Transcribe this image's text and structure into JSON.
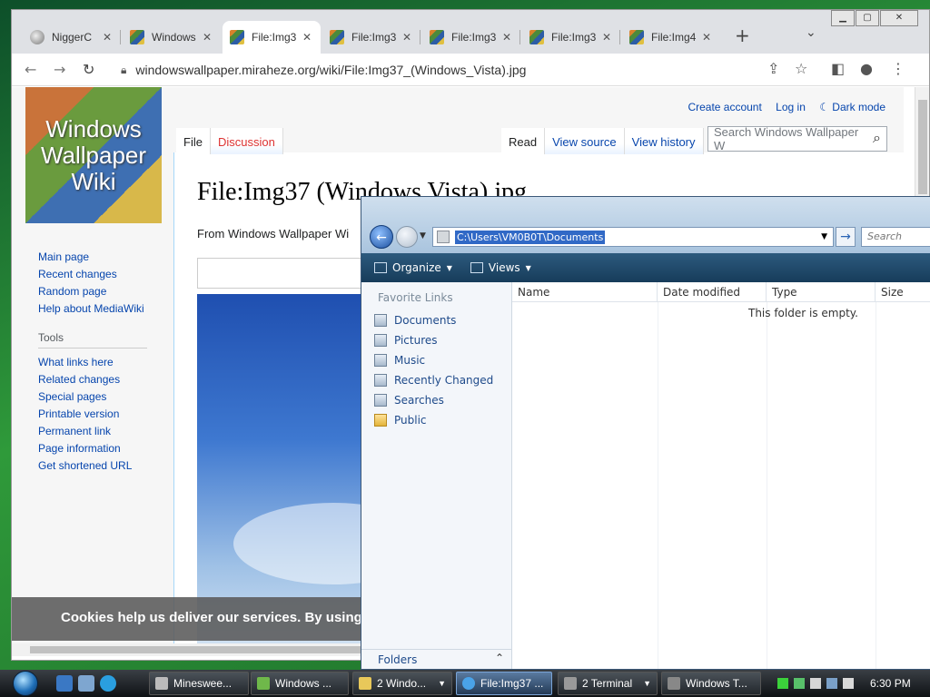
{
  "browser": {
    "tabs": [
      {
        "title": "NiggerC",
        "type": "round"
      },
      {
        "title": "Windows",
        "type": "wiki"
      },
      {
        "title": "File:Img3",
        "type": "wiki",
        "active": true
      },
      {
        "title": "File:Img3",
        "type": "wiki"
      },
      {
        "title": "File:Img3",
        "type": "wiki"
      },
      {
        "title": "File:Img3",
        "type": "wiki"
      },
      {
        "title": "File:Img4",
        "type": "wiki"
      }
    ],
    "close_glyph": "✕",
    "new_tab_glyph": "+",
    "url": "windowswallpaper.miraheze.org/wiki/File:Img37_(Windows_Vista).jpg"
  },
  "wiki": {
    "logo_text_1": "Windows",
    "logo_text_2": "Wallpaper",
    "logo_text_3": "Wiki",
    "user_links": {
      "create": "Create account",
      "login": "Log in",
      "dark": "☾ Dark mode"
    },
    "tabs_left": {
      "file": "File",
      "discussion": "Discussion"
    },
    "tabs_right": {
      "read": "Read",
      "view_source": "View source",
      "view_history": "View history"
    },
    "search_placeholder": "Search Windows Wallpaper W",
    "title": "File:Img37 (Windows Vista).jpg",
    "from": "From Windows Wallpaper Wi",
    "cookie": "Cookies help us deliver our services. By using",
    "nav": {
      "items": [
        "Main page",
        "Recent changes",
        "Random page",
        "Help about MediaWiki"
      ],
      "tools_header": "Tools",
      "tools": [
        "What links here",
        "Related changes",
        "Special pages",
        "Printable version",
        "Permanent link",
        "Page information",
        "Get shortened URL"
      ]
    }
  },
  "explorer": {
    "path": "C:\\Users\\VM0B0T\\Documents",
    "search_placeholder": "Search",
    "organize": "Organize",
    "views": "Views",
    "favorite_header": "Favorite Links",
    "favorites": [
      "Documents",
      "Pictures",
      "Music",
      "Recently Changed",
      "Searches",
      "Public"
    ],
    "folders": "Folders",
    "columns": {
      "name": "Name",
      "date": "Date modified",
      "type": "Type",
      "size": "Size"
    },
    "empty_text": "This folder is empty."
  },
  "taskbar": {
    "items": [
      {
        "label": "Mineswee...",
        "color": "#bbbbbb"
      },
      {
        "label": "Windows ...",
        "color": "#6fb84a"
      },
      {
        "label": "2 Windo...",
        "color": "#e8c85a",
        "dropdown": true
      },
      {
        "label": "File:Img37 ...",
        "color": "#4aa3e8",
        "active": true
      },
      {
        "label": "2 Terminal",
        "color": "#999999",
        "dropdown": true
      },
      {
        "label": "Windows T...",
        "color": "#888888"
      }
    ],
    "clock": "6:30 PM"
  }
}
